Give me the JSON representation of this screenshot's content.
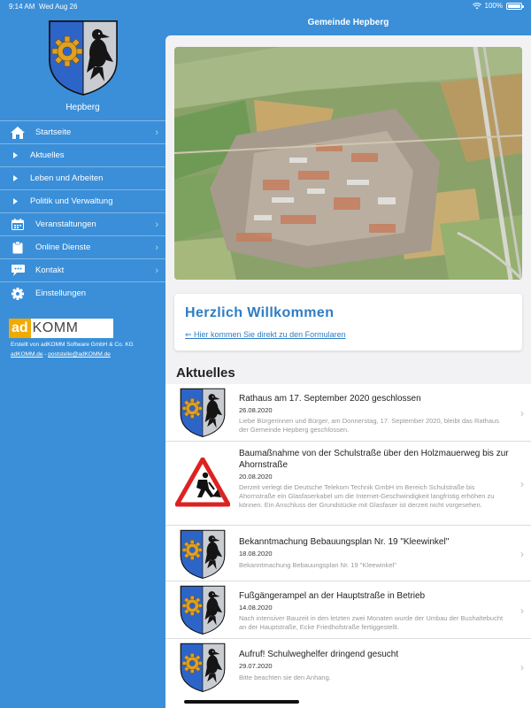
{
  "status": {
    "time": "9:14 AM",
    "date": "Wed Aug 26",
    "battery": "100%",
    "battery_level": 1.0
  },
  "header": {
    "title": "Gemeinde Hepberg"
  },
  "sidebar": {
    "town": "Hepberg",
    "items": [
      {
        "label": "Startseite",
        "icon": "home-icon"
      },
      {
        "label": "Aktuelles",
        "icon": "caret-right-icon"
      },
      {
        "label": "Leben und Arbeiten",
        "icon": "caret-right-icon"
      },
      {
        "label": "Politik und Verwaltung",
        "icon": "caret-right-icon"
      },
      {
        "label": "Veranstaltungen",
        "icon": "calendar-icon"
      },
      {
        "label": "Online Dienste",
        "icon": "clipboard-icon"
      },
      {
        "label": "Kontakt",
        "icon": "chat-icon"
      },
      {
        "label": "Einstellungen",
        "icon": "gear-icon"
      }
    ],
    "logo_a": "ad",
    "logo_b": "KOMM",
    "credit": "Erstellt von adKOMM Software GmbH & Co. KG",
    "link1": "adKOMM.de",
    "sep": " - ",
    "link2": "poststelle@adKOMM.de"
  },
  "welcome": {
    "title": "Herzlich Willkommen",
    "link": "⇐ Hier kommen Sie direkt zu den Formularen"
  },
  "news": {
    "heading": "Aktuelles",
    "items": [
      {
        "title": "Rathaus am 17. September 2020 geschlossen",
        "date": "26.08.2020",
        "teaser": "Liebe Bürgerinnen und Bürger,  am Donnerstag, 17. September 2020, bleibt das Rathaus der Gemeinde Hepberg geschlossen."
      },
      {
        "title": "Baumaßnahme von der Schulstraße über den Holzmauerweg bis zur Ahornstraße",
        "date": "20.08.2020",
        "teaser": "Derzeit verlegt die Deutsche Telekom Technik GmbH im Bereich Schulstraße bis Ahornstraße ein Glasfaserkabel um die Internet-Geschwindigkeit langfristig erhöhen zu können. Ein Anschluss der Grundstücke mit Glasfaser ist derzeit nicht vorgesehen."
      },
      {
        "title": "Bekanntmachung Bebauungsplan Nr. 19 \"Kleewinkel\"",
        "date": "18.08.2020",
        "teaser": "Bekanntmachung Bebauungsplan Nr. 19 \"Kleewinkel\""
      },
      {
        "title": "Fußgängerampel an der Hauptstraße in Betrieb",
        "date": "14.08.2020",
        "teaser": "Nach intensiver Bauzeit in den letzten zwei Monaten wurde der Umbau der Bushaltebucht an der Hauptstraße, Ecke Friedhofstraße fertiggestellt."
      },
      {
        "title": "Aufruf! Schulweghelfer dringend gesucht",
        "date": "29.07.2020",
        "teaser": "Bitte beachten sie den Anhang."
      }
    ]
  }
}
